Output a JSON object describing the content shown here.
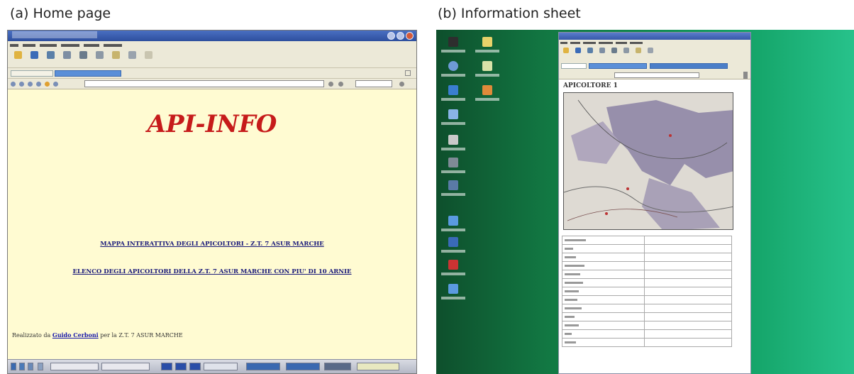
{
  "captions": {
    "a": "(a)  Home page",
    "b": "(b)  Information sheet"
  },
  "colors": {
    "title_red": "#c61b1b",
    "page_bg": "#fffbd2",
    "link_blue": "#1a1a7a",
    "desktop_green": "#127a44"
  },
  "home": {
    "title": "API-INFO",
    "links": [
      "MAPPA INTERATTIVA DEGLI APICOLTORI - Z.T. 7 ASUR MARCHE",
      "ELENCO DEGLI APICOLTORI DELLA Z.T. 7 ASUR MARCHE CON PIU' DI 10 ARNIE"
    ],
    "credit_prefix": "Realizzato da",
    "credit_author": "Guido Cerboni",
    "credit_suffix": "per la Z.T. 7 ASUR MARCHE"
  },
  "sheet": {
    "title": "APICOLTORE 1"
  },
  "icons": {
    "back": "back-arrow-icon",
    "forward": "forward-arrow-icon",
    "stop": "stop-icon",
    "refresh": "refresh-icon",
    "home": "home-icon",
    "search": "search-icon",
    "favorites": "favorites-star-icon",
    "print": "printer-icon",
    "minimize": "minimize-icon",
    "maximize": "maximize-icon",
    "close": "close-icon"
  }
}
